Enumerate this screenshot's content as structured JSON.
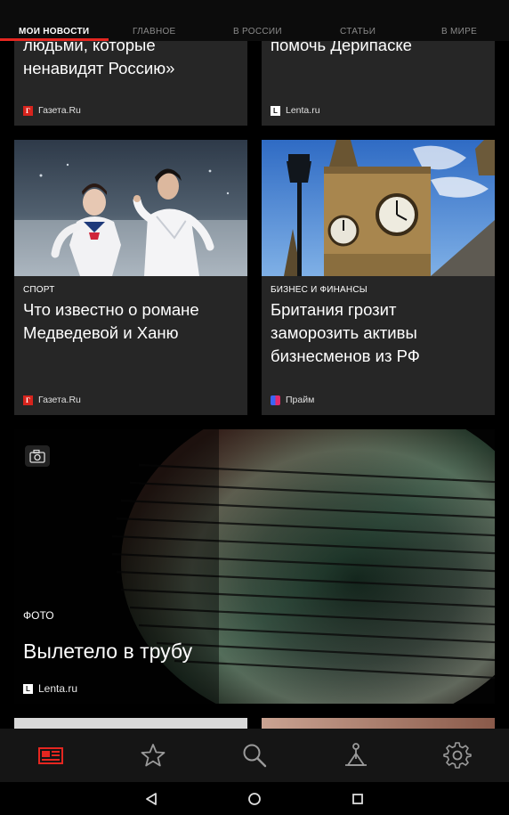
{
  "tabs": [
    {
      "label": "МОИ НОВОСТИ",
      "active": true
    },
    {
      "label": "ГЛАВНОЕ"
    },
    {
      "label": "В РОССИИ"
    },
    {
      "label": "СТАТЬИ"
    },
    {
      "label": "В МИРЕ"
    }
  ],
  "cards": {
    "top_left": {
      "title_lines": [
        "людьми, которые",
        "ненавидят Россию»"
      ],
      "source": "Газета.Ru",
      "logo": "gazeta-logo-icon"
    },
    "top_right": {
      "title_lines": [
        "помочь Дерипаске"
      ],
      "source": "Lenta.ru",
      "logo": "lenta-logo-icon"
    },
    "sport": {
      "category": "СПОРТ",
      "title_lines": [
        "Что известно о романе",
        "Медведевой и Ханю"
      ],
      "source": "Газета.Ru",
      "logo": "gazeta-logo-icon",
      "image": "figure-skaters-photo"
    },
    "business": {
      "category": "БИЗНЕС И ФИНАНСЫ",
      "title_lines": [
        "Британия грозит",
        "заморозить активы",
        "бизнесменов из РФ"
      ],
      "source": "Прайм",
      "logo": "prime-logo-icon",
      "image": "big-ben-photo"
    },
    "photo": {
      "category": "ФОТО",
      "title": "Вылетело в трубу",
      "source": "Lenta.ru",
      "logo": "lenta-logo-icon",
      "icon": "camera-icon",
      "image": "tunnel-photo"
    }
  },
  "logos": {
    "gazeta": "Г",
    "lenta": "L"
  },
  "bottom_nav": [
    {
      "icon": "news-feed-icon",
      "active": true
    },
    {
      "icon": "star-icon"
    },
    {
      "icon": "search-icon"
    },
    {
      "icon": "explore-icon"
    },
    {
      "icon": "gear-icon"
    }
  ],
  "system_nav": [
    "back-icon",
    "home-icon",
    "recents-icon"
  ],
  "colors": {
    "accent": "#e52620",
    "card_bg": "#262626",
    "bg": "#000000",
    "nav_bg": "#151515"
  }
}
